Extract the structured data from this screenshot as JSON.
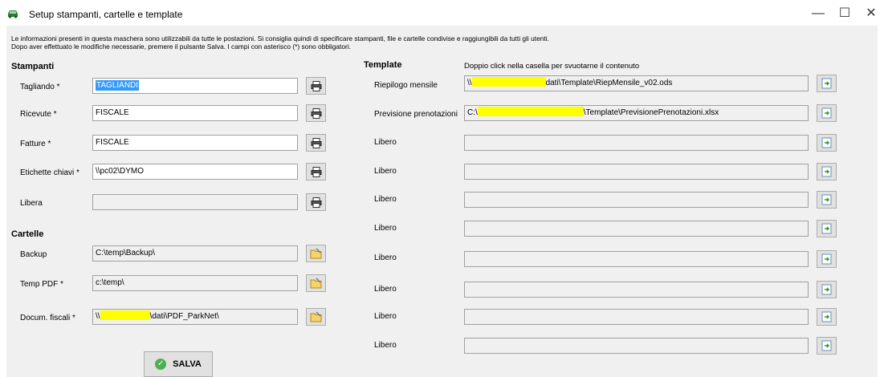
{
  "window": {
    "title": "Setup stampanti, cartelle e template",
    "min_glyph": "—",
    "max_glyph": "☐",
    "close_glyph": "✕"
  },
  "info": {
    "line1": "Le informazioni presenti in questa maschera sono utilizzabili da tutte le postazioni. Si consiglia quindi di specificare stampanti, file e cartelle condivise e raggiungibili da tutti gli utenti.",
    "line2": "Dopo aver effettuato le modifiche necessarie, premere il pulsante Salva. I campi con asterisco (*) sono obbligatori."
  },
  "stampanti": {
    "title": "Stampanti",
    "rows": [
      {
        "label": "Tagliando *",
        "value": "TAGLIANDI"
      },
      {
        "label": "Ricevute *",
        "value": "FISCALE"
      },
      {
        "label": "Fatture *",
        "value": "FISCALE"
      },
      {
        "label": "Etichette chiavi *",
        "value": "\\\\pc02\\DYMO"
      },
      {
        "label": "Libera",
        "value": ""
      }
    ]
  },
  "cartelle": {
    "title": "Cartelle",
    "rows": [
      {
        "label": "Backup",
        "value": "C:\\temp\\Backup\\"
      },
      {
        "label": "Temp PDF *",
        "value": "c:\\temp\\"
      },
      {
        "label": "Docum. fiscali *",
        "value_prefix": "\\\\",
        "value_suffix": "\\dati\\PDF_ParkNet\\"
      }
    ]
  },
  "template": {
    "title": "Template",
    "hint": "Doppio click nella casella per svuotarne il contenuto",
    "rows": [
      {
        "label": "Riepilogo mensile",
        "value_prefix": "\\\\",
        "value_suffix": "dati\\Template\\RiepMensile_v02.ods"
      },
      {
        "label": "Previsione prenotazioni",
        "value_prefix": "C:\\",
        "value_suffix": "\\Template\\PrevisionePrenotazioni.xlsx"
      },
      {
        "label": "Libero",
        "value": ""
      },
      {
        "label": "Libero",
        "value": ""
      },
      {
        "label": "Libero",
        "value": ""
      },
      {
        "label": "Libero",
        "value": ""
      },
      {
        "label": "Libero",
        "value": ""
      },
      {
        "label": "Libero",
        "value": ""
      },
      {
        "label": "Libero",
        "value": ""
      },
      {
        "label": "Libero",
        "value": ""
      }
    ]
  },
  "save": {
    "label": "SALVA"
  },
  "colors": {
    "highlight": "#ffff00",
    "selection": "#3399ff",
    "form_bg": "#f0f0f0"
  }
}
